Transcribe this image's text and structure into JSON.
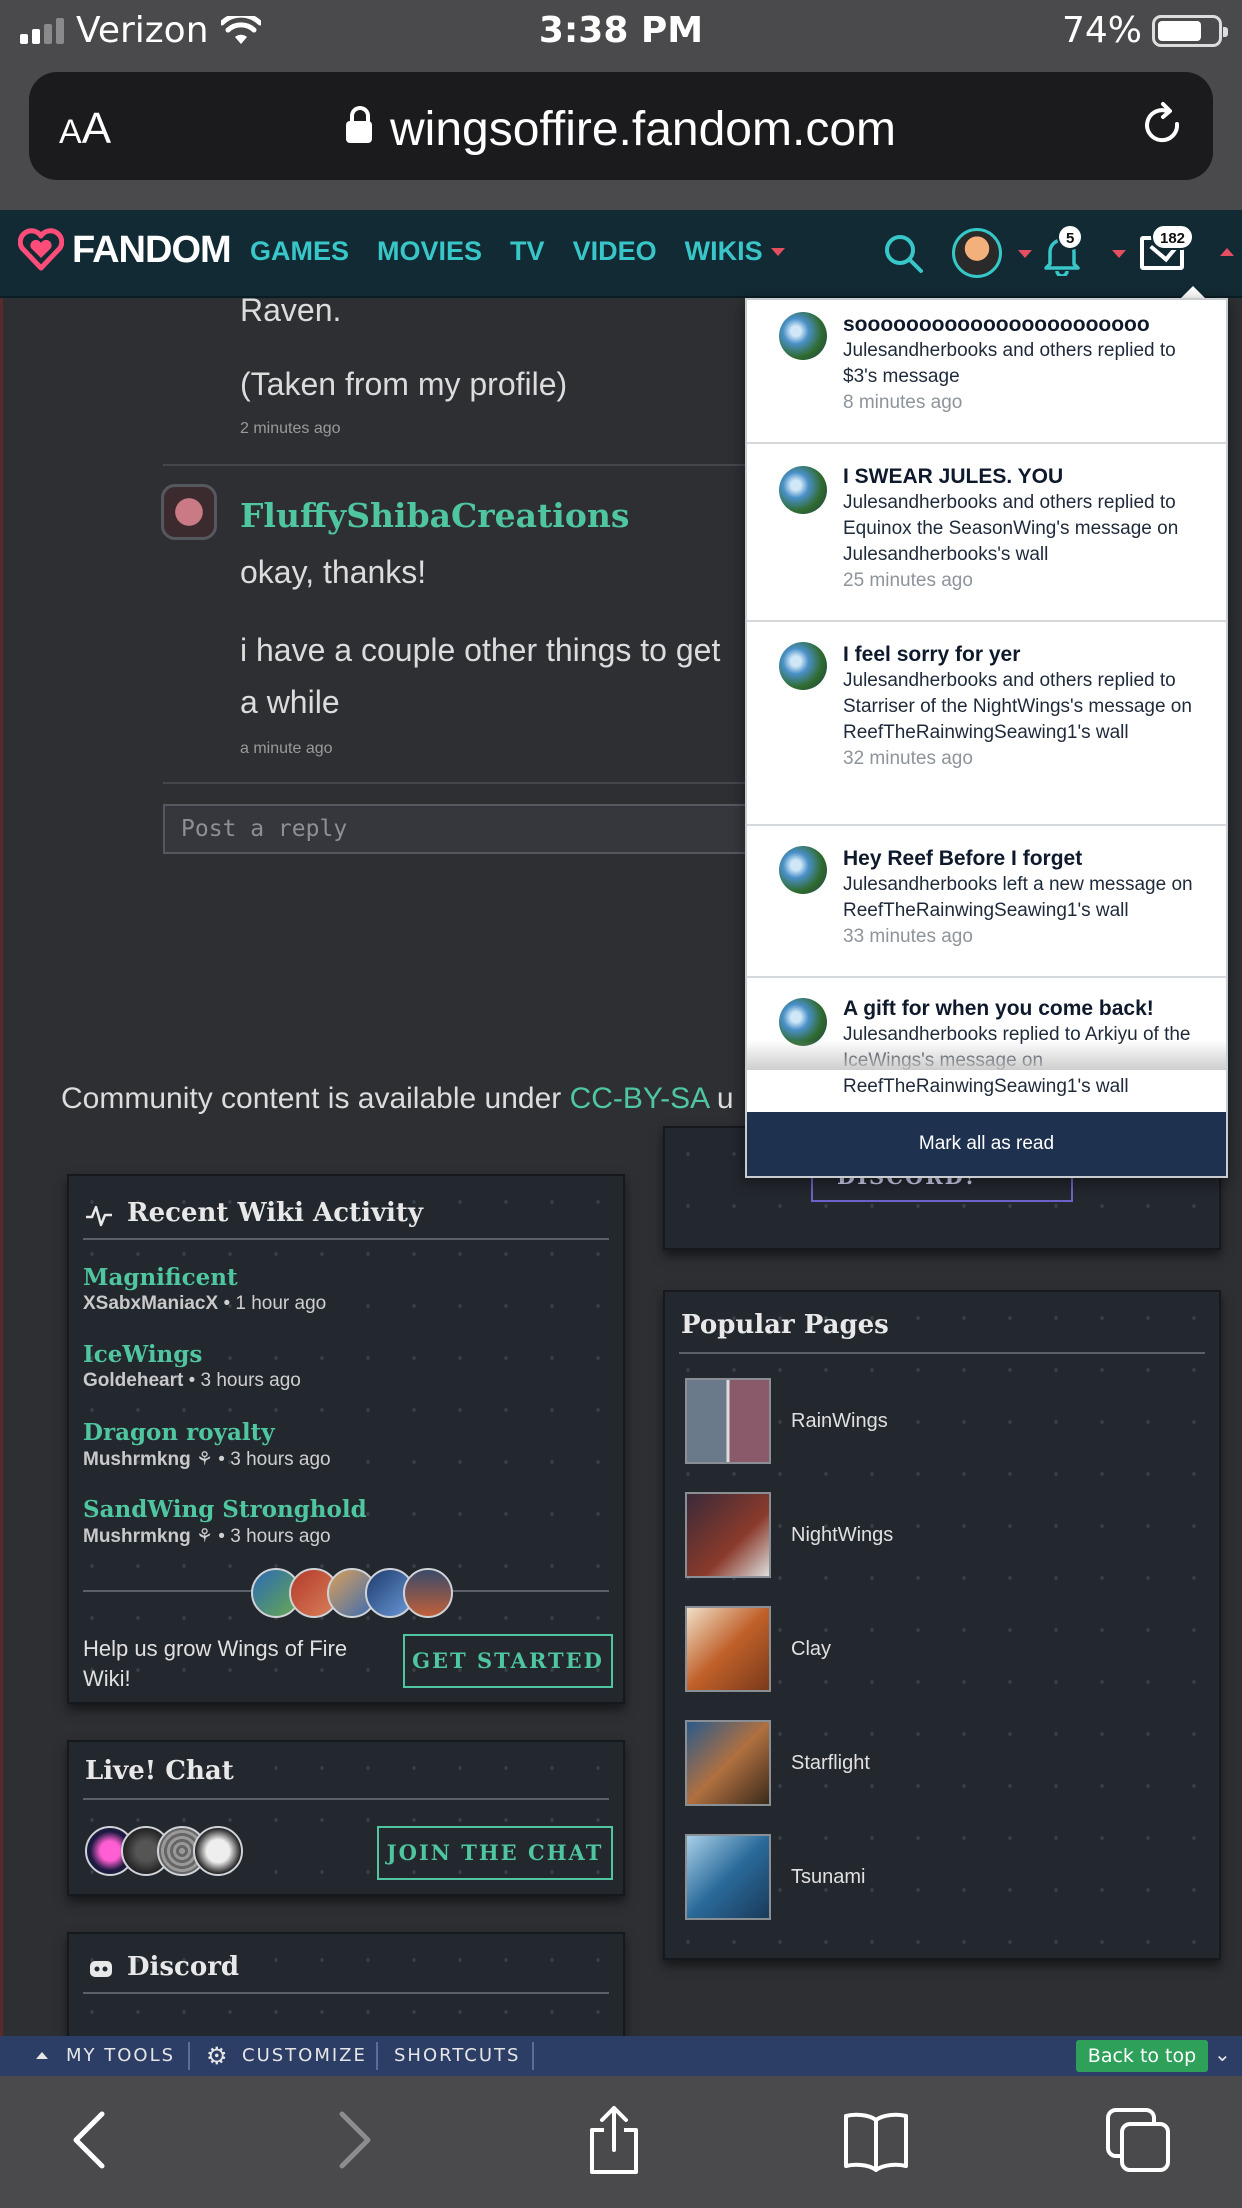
{
  "status_bar": {
    "carrier": "Verizon",
    "time": "3:38 PM",
    "battery_percent": "74%",
    "battery_level": 0.74
  },
  "browser": {
    "text_size_label": "AA",
    "url": "wingsoffire.fandom.com"
  },
  "fandom_nav": {
    "logo": "FANDOM",
    "links": [
      "GAMES",
      "MOVIES",
      "TV",
      "VIDEO",
      "WIKIS"
    ],
    "notifications_count": "5",
    "messages_count": "182"
  },
  "thread": {
    "prev_text_1": "Raven.",
    "prev_text_2": "(Taken from my profile)",
    "prev_time": "2 minutes ago",
    "reply_author": "FluffyShibaCreations",
    "reply_text_1": "okay, thanks!",
    "reply_text_2_line1": "i have a couple other things to get",
    "reply_text_2_line2": "a while",
    "reply_time": "a minute ago",
    "reply_placeholder": "Post a reply"
  },
  "footer": {
    "prefix": "Community content is available under ",
    "license": "CC-BY-SA",
    "suffix": " u"
  },
  "recent_activity": {
    "title": "Recent Wiki Activity",
    "items": [
      {
        "page": "Magnificent",
        "user": "XSabxManiacX",
        "time": "• 1 hour ago"
      },
      {
        "page": "IceWings",
        "user": "Goldeheart",
        "time": "• 3 hours ago"
      },
      {
        "page": "Dragon royalty",
        "user": "Mushrmkng",
        "time": "• 3 hours ago"
      },
      {
        "page": "SandWing Stronghold",
        "user": "Mushrmkng",
        "time": "• 3 hours ago"
      }
    ],
    "help_text": "Help us grow Wings of Fire Wiki!",
    "cta": "GET STARTED"
  },
  "live_chat": {
    "title": "Live! Chat",
    "cta": "JOIN THE CHAT"
  },
  "discord_widget": {
    "title": "Discord",
    "cta": "JOIN THE DISCORD!"
  },
  "popular_pages": {
    "title": "Popular Pages",
    "items": [
      "RainWings",
      "NightWings",
      "Clay",
      "Starflight",
      "Tsunami"
    ]
  },
  "notifications": {
    "items": [
      {
        "title": "sooooooooooooooooooooooo",
        "body": "Julesandherbooks and others replied to $3's message",
        "time": "8 minutes ago"
      },
      {
        "title": "I SWEAR JULES. YOU",
        "body": "Julesandherbooks and others replied to Equinox the SeasonWing's message on Julesandherbooks's wall",
        "time": "25 minutes ago"
      },
      {
        "title": "I feel sorry for yer",
        "body": "Julesandherbooks and others replied to Starriser of the NightWings's message on ReefTheRainwingSeawing1's wall",
        "time": "32 minutes ago"
      },
      {
        "title": "Hey Reef Before I forget",
        "body": "Julesandherbooks left a new message on ReefTheRainwingSeawing1's wall",
        "time": "33 minutes ago"
      },
      {
        "title": "A gift for when you come back!",
        "body": "Julesandherbooks replied to Arkiyu of the IceWings's message on ReefTheRainwingSeawing1's wall",
        "time": ""
      }
    ],
    "mark_all": "Mark all as read"
  },
  "my_tools": {
    "my_tools": "MY TOOLS",
    "customize": "CUSTOMIZE",
    "shortcuts": "SHORTCUTS",
    "back_to_top": "Back to top"
  }
}
